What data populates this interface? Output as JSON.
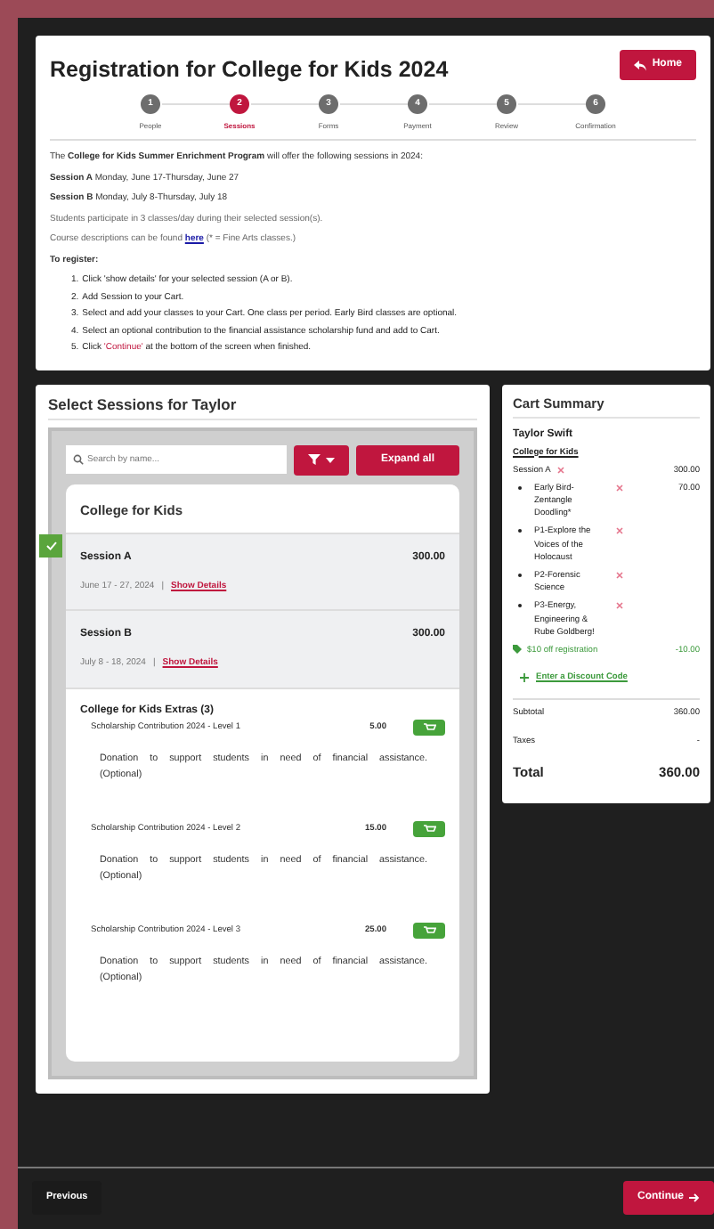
{
  "header": {
    "title": "Registration for College for Kids 2024",
    "home_button": "Home"
  },
  "steps": [
    {
      "number": "1",
      "label": "People",
      "selected": false
    },
    {
      "number": "2",
      "label": "Sessions",
      "selected": true
    },
    {
      "number": "3",
      "label": "Forms",
      "selected": false
    },
    {
      "number": "4",
      "label": "Payment",
      "selected": false
    },
    {
      "number": "5",
      "label": "Review",
      "selected": false
    },
    {
      "number": "6",
      "label": "Confirmation",
      "selected": false
    }
  ],
  "intro": [
    "The **College for Kids Summer Enrichment Program** will offer the following sessions in 2024:",
    "**Session A** Monday, June 17-Thursday, June 27",
    "**Session B** Monday, July 8-Thursday, July 18",
    "Students participate in 3 classes/day during their selected session(s)."
  ],
  "course_link": {
    "before": "Course descriptions can be found ",
    "link": "here",
    "after": " (* = Fine Arts classes.)"
  },
  "register": {
    "heading": "To register:",
    "steps": [
      {
        "number": "1.",
        "text": "Click 'show details' for your selected session (A or B)."
      },
      {
        "number": "2.",
        "text": "Add Session to your Cart."
      },
      {
        "number": "3.",
        "text": "Select and add your classes to your Cart. One class per period. Early Bird classes are optional."
      },
      {
        "number": "4.",
        "text": "Select an optional contribution to the financial assistance scholarship fund and add to Cart."
      },
      {
        "number": "5.",
        "text": "Click ",
        "highlight": "'Continue'",
        "after": " at the bottom of the screen when finished."
      }
    ]
  },
  "sessions_panel": {
    "title": "Select Sessions for Taylor",
    "search": {
      "placeholder": "Search by name..."
    },
    "expand_button": "Expand all",
    "group_title": "College for Kids",
    "sessions": [
      {
        "name": "Session A",
        "price": "300.00",
        "dates": "June 17 - 27, 2024",
        "separator": "|",
        "details_link": "Show Details",
        "selected": true
      },
      {
        "name": "Session B",
        "price": "300.00",
        "dates": "July 8 - 18, 2024",
        "separator": "|",
        "details_link": "Show Details",
        "selected": false
      }
    ],
    "extras": {
      "title": "College for Kids Extras (3)",
      "items": [
        {
          "name": "Scholarship Contribution 2024 - Level 1",
          "price": "5.00",
          "description": "Donation to support students in need of financial assistance. (Optional)"
        },
        {
          "name": "Scholarship Contribution 2024 - Level 2",
          "price": "15.00",
          "description": "Donation to support students in need of financial assistance. (Optional)"
        },
        {
          "name": "Scholarship Contribution 2024 - Level 3",
          "price": "25.00",
          "description": "Donation to support students in need of financial assistance. (Optional)"
        }
      ]
    }
  },
  "cart": {
    "title": "Cart Summary",
    "person": "Taylor Swift",
    "program": "College for Kids",
    "session": {
      "name": "Session A",
      "price": "300.00"
    },
    "items": [
      {
        "name": "Early Bird-Zentangle Doodling*",
        "price": "70.00"
      },
      {
        "name": "P1-Explore the Voices of the Holocaust"
      },
      {
        "name": "P2-Forensic Science"
      },
      {
        "name": "P3-Energy, Engineering & Rube Goldberg!"
      }
    ],
    "discount": {
      "name": "$10 off registration",
      "amount": "-10.00"
    },
    "discount_code_link": "Enter a Discount Code",
    "totals": [
      {
        "kind": "line",
        "label": "Subtotal",
        "value": "360.00"
      },
      {
        "kind": "line",
        "label": "Taxes",
        "value": "-"
      },
      {
        "kind": "grand",
        "label": "Total",
        "value": "360.00"
      }
    ]
  },
  "footer": {
    "previous": "Previous",
    "continue": "Continue"
  }
}
